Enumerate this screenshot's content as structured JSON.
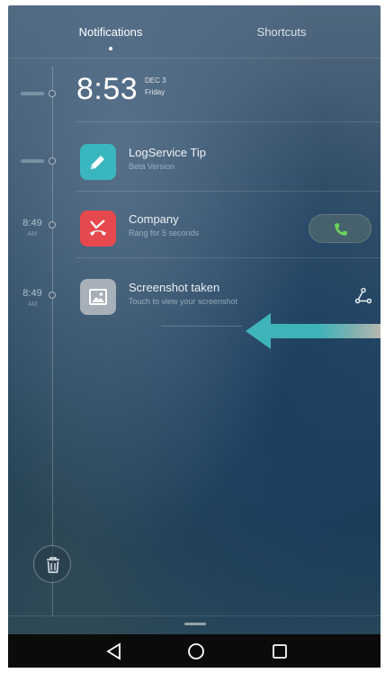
{
  "tabs": {
    "notifications": "Notifications",
    "shortcuts": "Shortcuts"
  },
  "clock": {
    "time": "8:53",
    "date": "DEC 3",
    "day": "Friday"
  },
  "timeline": [
    {
      "time": "",
      "sub": ""
    },
    {
      "time": "",
      "sub": ""
    },
    {
      "time": "8:49",
      "sub": "AM"
    },
    {
      "time": "8:49",
      "sub": "AM"
    }
  ],
  "notifications": [
    {
      "title": "LogService Tip",
      "subtitle": "Beta Version",
      "icon": "pencil-icon",
      "color": "#3ab7be"
    },
    {
      "title": "Company",
      "subtitle": "Rang for 5 seconds",
      "icon": "missed-call-icon",
      "color": "#e5484d"
    },
    {
      "title": "Screenshot taken",
      "subtitle": "Touch to view your screenshot",
      "icon": "image-icon",
      "color": "#a7afb8"
    }
  ],
  "actions": {
    "call_icon": "phone-icon",
    "share_icon": "share-icon",
    "clear_icon": "trash-icon"
  },
  "navbar": {
    "back": "back-icon",
    "home": "home-icon",
    "recent": "recent-apps-icon"
  },
  "colors": {
    "arrow": "#3fb3ba",
    "call_green": "#6bd15a"
  }
}
